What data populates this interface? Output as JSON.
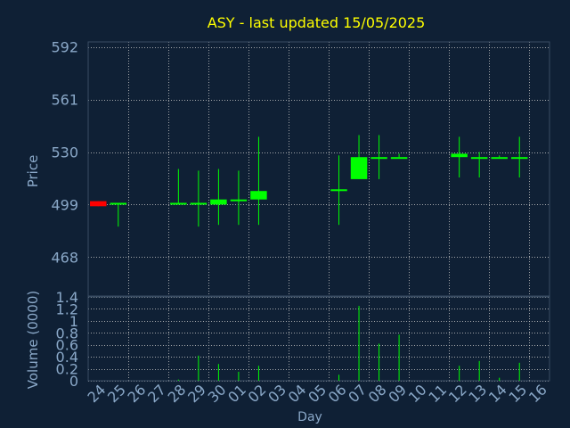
{
  "chart_data": {
    "type": "candlestick",
    "title": "ASY - last updated 15/05/2025",
    "xlabel": "Day",
    "price_ylabel": "Price",
    "volume_ylabel": "Volume (0000)",
    "x_ticks": [
      "24",
      "25",
      "26",
      "27",
      "28",
      "29",
      "30",
      "01",
      "02",
      "03",
      "04",
      "05",
      "06",
      "07",
      "08",
      "09",
      "10",
      "11",
      "12",
      "13",
      "14",
      "15",
      "16"
    ],
    "price_ticks": [
      "592",
      "561",
      "530",
      "499",
      "468"
    ],
    "price_tick_values": [
      592,
      561,
      530,
      499,
      468
    ],
    "volume_ticks": [
      "1.4",
      "1.2",
      "1",
      "0.8",
      "0.6",
      "0.4",
      "0.2",
      "0"
    ],
    "volume_tick_values": [
      1.4,
      1.2,
      1.0,
      0.8,
      0.6,
      0.4,
      0.2,
      0
    ],
    "price_ylim": [
      445,
      595
    ],
    "volume_ylim": [
      0,
      1.4
    ],
    "grid": true,
    "colors": {
      "background": "#0f2035",
      "title": "#ffff00",
      "axis_text": "#8aa8c8",
      "grid": "#c8c8c8",
      "up": "#00ff00",
      "down": "#ff0000"
    },
    "candles": [
      {
        "day": "24",
        "open": 501,
        "high": 501,
        "low": 498,
        "close": 498
      },
      {
        "day": "25",
        "open": 500,
        "high": 500,
        "low": 486,
        "close": 500
      },
      {
        "day": "28",
        "open": 500,
        "high": 520,
        "low": 500,
        "close": 500
      },
      {
        "day": "29",
        "open": 500,
        "high": 519,
        "low": 486,
        "close": 500
      },
      {
        "day": "30",
        "open": 499,
        "high": 520,
        "low": 487,
        "close": 502
      },
      {
        "day": "01",
        "open": 501,
        "high": 519,
        "low": 487,
        "close": 502
      },
      {
        "day": "02",
        "open": 502,
        "high": 539,
        "low": 487,
        "close": 507
      },
      {
        "day": "06",
        "open": 508,
        "high": 528,
        "low": 487,
        "close": 508
      },
      {
        "day": "07",
        "open": 514,
        "high": 540,
        "low": 514,
        "close": 527
      },
      {
        "day": "08",
        "open": 527,
        "high": 540,
        "low": 514,
        "close": 527
      },
      {
        "day": "09",
        "open": 527,
        "high": 529,
        "low": 527,
        "close": 527
      },
      {
        "day": "12",
        "open": 527,
        "high": 539,
        "low": 515,
        "close": 529
      },
      {
        "day": "13",
        "open": 527,
        "high": 530,
        "low": 515,
        "close": 527
      },
      {
        "day": "14",
        "open": 527,
        "high": 528,
        "low": 527,
        "close": 527
      },
      {
        "day": "15",
        "open": 527,
        "high": 539,
        "low": 515,
        "close": 527
      }
    ],
    "volumes": [
      {
        "day": "24",
        "value": 0
      },
      {
        "day": "25",
        "value": 0
      },
      {
        "day": "28",
        "value": 0.02
      },
      {
        "day": "29",
        "value": 0.42
      },
      {
        "day": "30",
        "value": 0.28
      },
      {
        "day": "01",
        "value": 0.15
      },
      {
        "day": "02",
        "value": 0.25
      },
      {
        "day": "06",
        "value": 0.1
      },
      {
        "day": "07",
        "value": 1.25
      },
      {
        "day": "08",
        "value": 0.62
      },
      {
        "day": "09",
        "value": 0.77
      },
      {
        "day": "12",
        "value": 0.25
      },
      {
        "day": "13",
        "value": 0.33
      },
      {
        "day": "14",
        "value": 0.05
      },
      {
        "day": "15",
        "value": 0.3
      }
    ]
  }
}
